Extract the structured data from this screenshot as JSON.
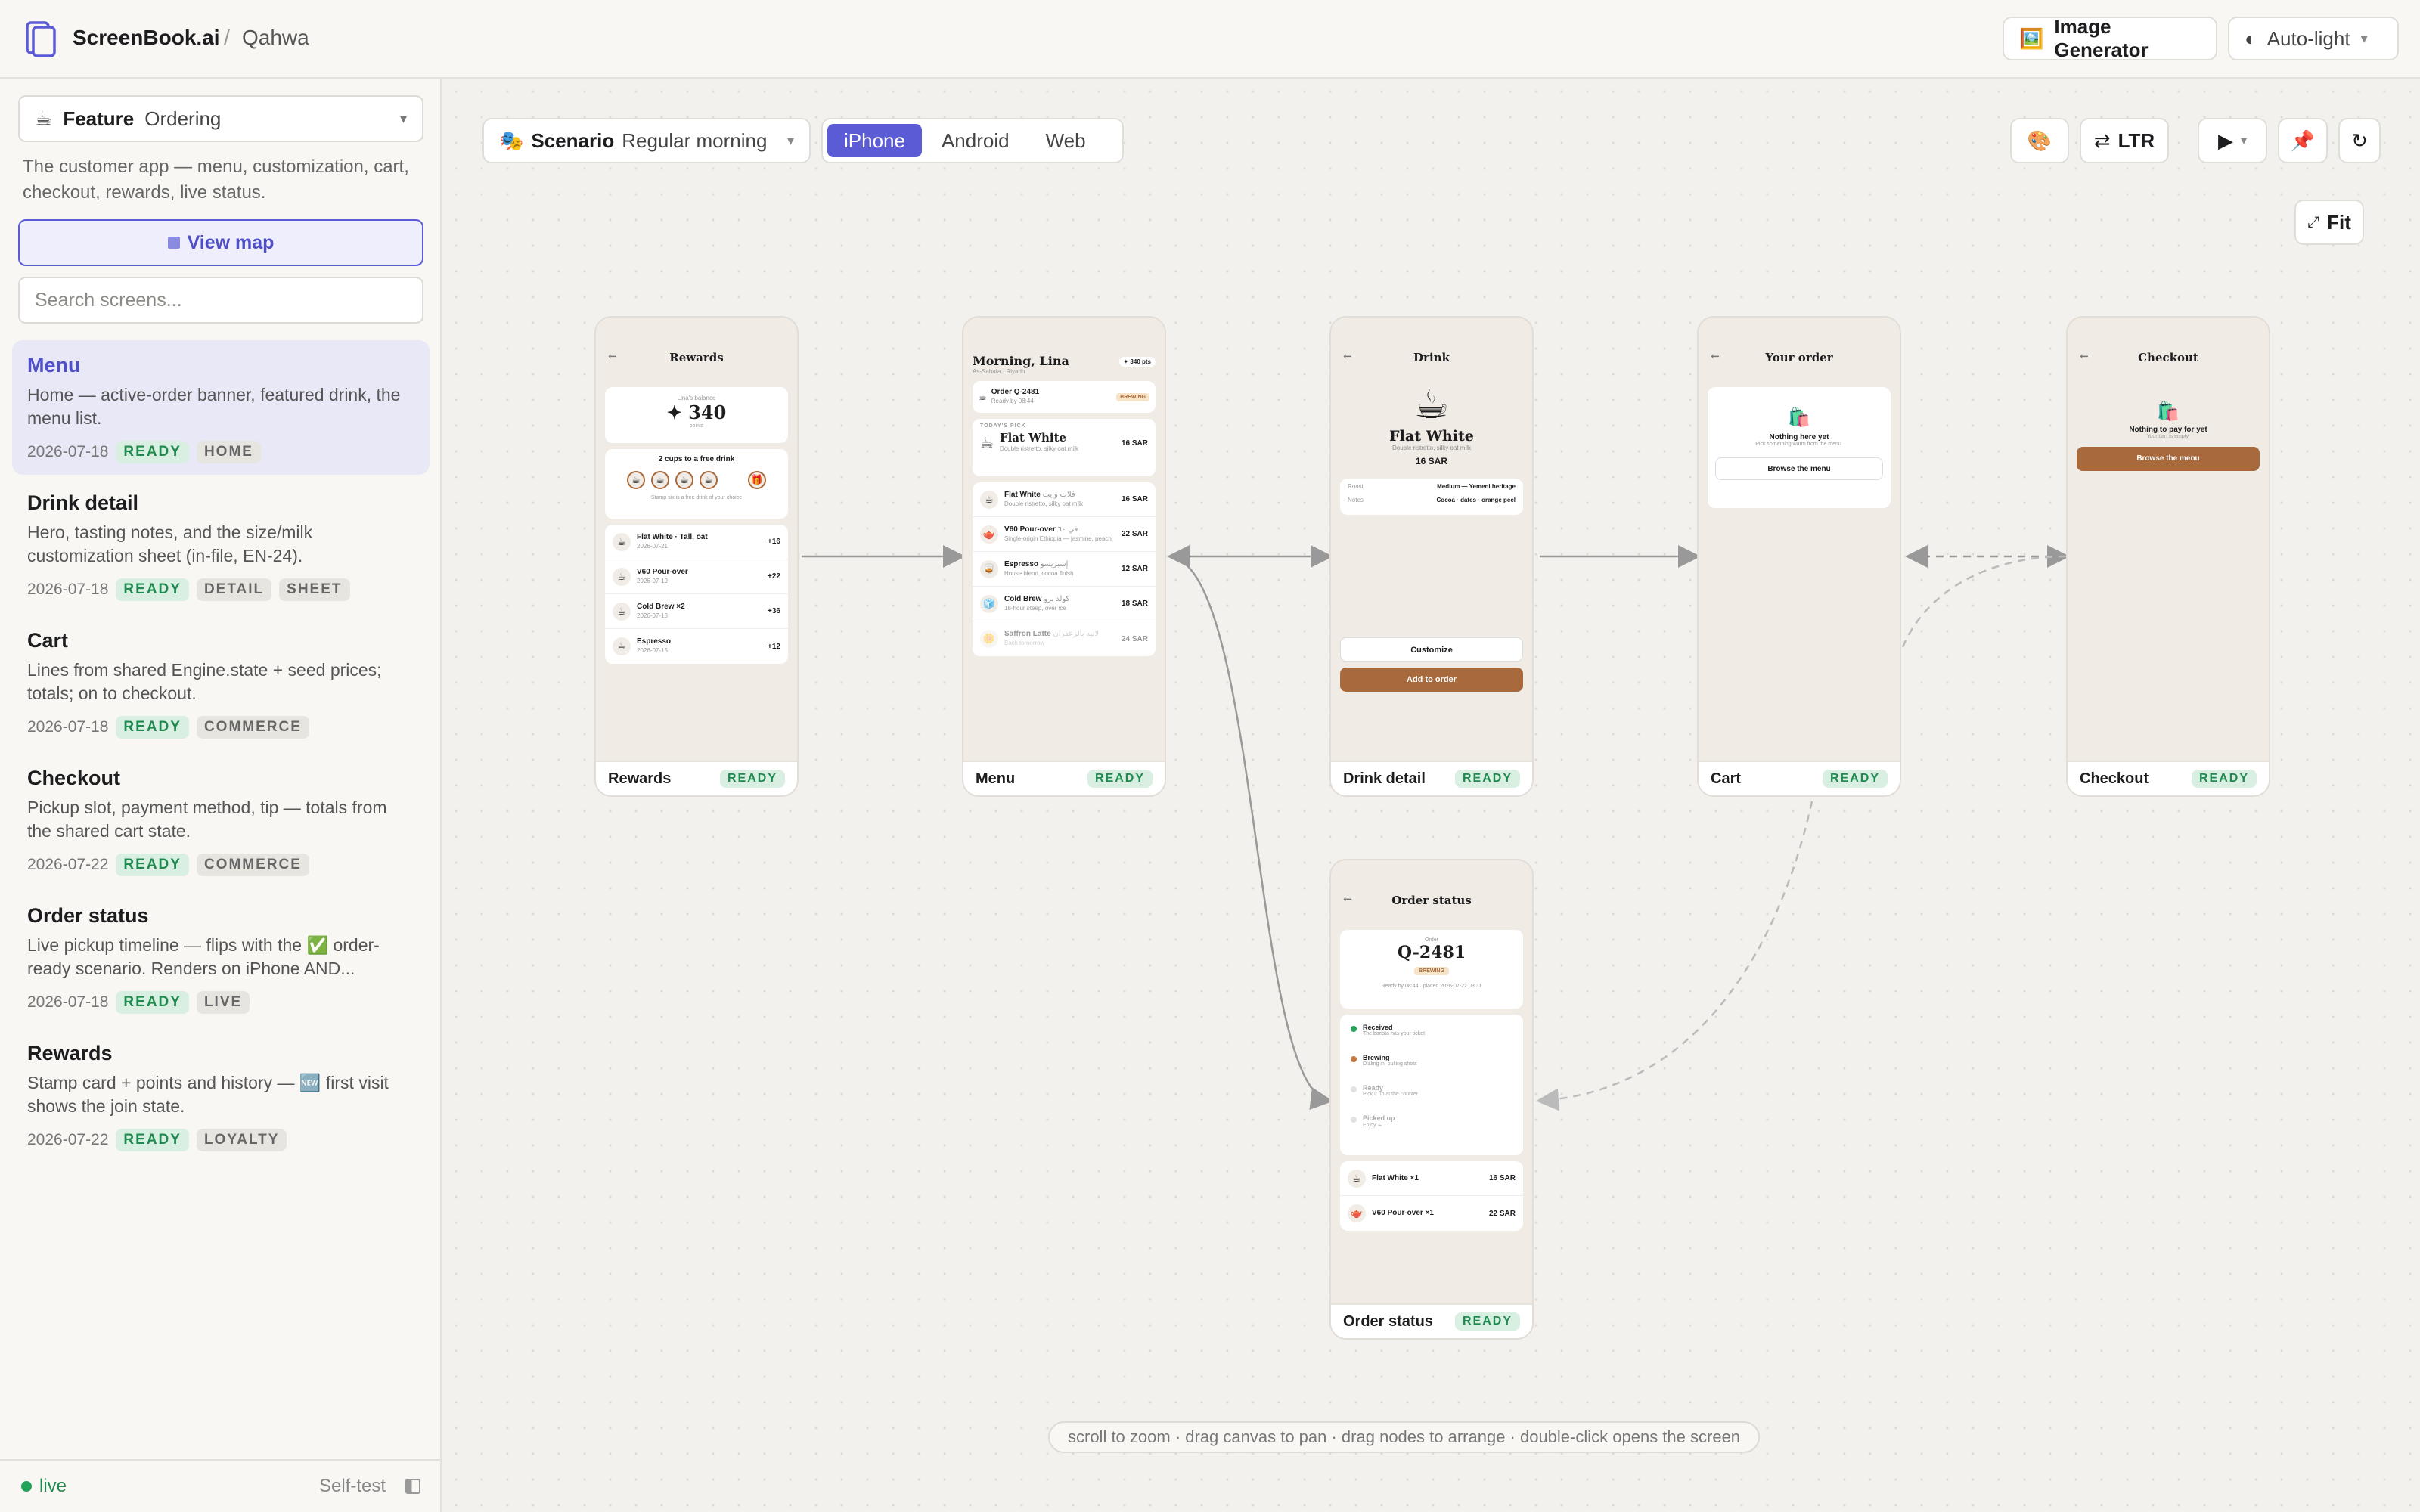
{
  "topbar": {
    "brand": "ScreenBook.ai",
    "sep": "/",
    "project": "Qahwa",
    "image_generator": "Image Generator",
    "theme": "Auto-light"
  },
  "sidebar": {
    "feature_label": "Feature",
    "feature_value": "Ordering",
    "feature_desc": "The customer app — menu, customization, cart, checkout, rewards, live status.",
    "view_map": "View map",
    "search_placeholder": "Search screens...",
    "items": [
      {
        "title": "Menu",
        "desc": "Home — active-order banner, featured drink, the menu list.",
        "date": "2026-07-18",
        "status": "READY",
        "tags": [
          "HOME"
        ]
      },
      {
        "title": "Drink detail",
        "desc": "Hero, tasting notes, and the size/milk customization sheet (in-file, EN-24).",
        "date": "2026-07-18",
        "status": "READY",
        "tags": [
          "DETAIL",
          "SHEET"
        ]
      },
      {
        "title": "Cart",
        "desc": "Lines from shared Engine.state + seed prices; totals; on to checkout.",
        "date": "2026-07-18",
        "status": "READY",
        "tags": [
          "COMMERCE"
        ]
      },
      {
        "title": "Checkout",
        "desc": "Pickup slot, payment method, tip — totals from the shared cart state.",
        "date": "2026-07-22",
        "status": "READY",
        "tags": [
          "COMMERCE"
        ]
      },
      {
        "title": "Order status",
        "desc": "Live pickup timeline — flips with the ✅ order-ready scenario. Renders on iPhone AND...",
        "date": "2026-07-18",
        "status": "READY",
        "tags": [
          "LIVE"
        ]
      },
      {
        "title": "Rewards",
        "desc": "Stamp card + points and history — 🆕 first visit shows the join state.",
        "date": "2026-07-22",
        "status": "READY",
        "tags": [
          "LOYALTY"
        ]
      }
    ],
    "footer": {
      "live": "live",
      "selftest": "Self-test"
    }
  },
  "toolbar": {
    "scenario_label": "Scenario",
    "scenario_value": "Regular morning",
    "platforms": [
      "iPhone",
      "Android",
      "Web"
    ],
    "direction": "LTR",
    "fit": "Fit"
  },
  "hint": "scroll to zoom · drag canvas to pan · drag nodes to arrange · double-click opens the screen",
  "cards": {
    "rewards": {
      "name": "Rewards",
      "status": "READY",
      "title": "Rewards",
      "balance_label": "Lina's balance",
      "points": "✦ 340",
      "points_unit": "points",
      "stamp_title": "2 cups to a free drink",
      "stamp_note": "Stamp six is a free drink of your choice",
      "history": [
        {
          "n": "Flat White · Tall, oat",
          "d": "2026-07-21",
          "v": "+16"
        },
        {
          "n": "V60 Pour-over",
          "d": "2026-07-19",
          "v": "+22"
        },
        {
          "n": "Cold Brew ×2",
          "d": "2026-07-18",
          "v": "+36"
        },
        {
          "n": "Espresso",
          "d": "2026-07-15",
          "v": "+12"
        }
      ]
    },
    "menu": {
      "name": "Menu",
      "status": "READY",
      "greeting": "Morning, Lina",
      "location": "As-Sahafa · Riyadh",
      "pts": "✦ 340 pts",
      "order": "Order Q-2481",
      "order_sub": "Ready by 08:44",
      "order_badge": "BREWING",
      "pick_label": "TODAY'S PICK",
      "pick_name": "Flat White",
      "pick_sub": "Double ristretto, silky oat milk",
      "pick_price": "16 SAR",
      "items": [
        {
          "n": "Flat White",
          "ar": "فلات وايت",
          "d": "Double ristretto, silky oat milk",
          "p": "16 SAR"
        },
        {
          "n": "V60 Pour-over",
          "ar": "في ٦٠",
          "d": "Single-origin Ethiopia — jasmine, peach",
          "p": "22 SAR"
        },
        {
          "n": "Espresso",
          "ar": "إسبريسو",
          "d": "House blend, cocoa finish",
          "p": "12 SAR"
        },
        {
          "n": "Cold Brew",
          "ar": "كولد برو",
          "d": "18-hour steep, over ice",
          "p": "18 SAR"
        },
        {
          "n": "Saffron Latte",
          "ar": "لاتيه بالزعفران",
          "d": "Back tomorrow",
          "p": "24 SAR"
        }
      ]
    },
    "drink": {
      "name": "Drink detail",
      "status": "READY",
      "title": "Drink",
      "drink": "Flat White",
      "sub": "Double ristretto, silky oat milk",
      "price": "16 SAR",
      "roast_k": "Roast",
      "roast_v": "Medium — Yemeni heritage",
      "notes_k": "Notes",
      "notes_v": "Cocoa · dates · orange peel",
      "customize": "Customize",
      "add": "Add to order"
    },
    "cart": {
      "name": "Cart",
      "status": "READY",
      "title": "Your order",
      "empty": "Nothing here yet",
      "empty_sub": "Pick something warm from the menu.",
      "browse": "Browse the menu"
    },
    "checkout": {
      "name": "Checkout",
      "status": "READY",
      "title": "Checkout",
      "empty": "Nothing to pay for yet",
      "empty_sub": "Your cart is empty.",
      "browse": "Browse the menu"
    },
    "status": {
      "name": "Order status",
      "status": "READY",
      "title": "Order status",
      "order_label": "Order",
      "order_id": "Q-2481",
      "badge": "BREWING",
      "ready": "Ready by 08:44 · placed 2026-07-22 08:31",
      "steps": [
        {
          "t": "Received",
          "s": "The barista has your ticket"
        },
        {
          "t": "Brewing",
          "s": "Dialing in, pulling shots"
        },
        {
          "t": "Ready",
          "s": "Pick it up at the counter"
        },
        {
          "t": "Picked up",
          "s": "Enjoy ☕"
        }
      ],
      "lines": [
        {
          "n": "Flat White ×1",
          "p": "16 SAR"
        },
        {
          "n": "V60 Pour-over ×1",
          "p": "22 SAR"
        }
      ]
    }
  },
  "colors": {
    "accent": "#5b5bd6",
    "brown": "#a8693c",
    "ready_bg": "#d9efe2",
    "ready_fg": "#1f8a4f"
  }
}
